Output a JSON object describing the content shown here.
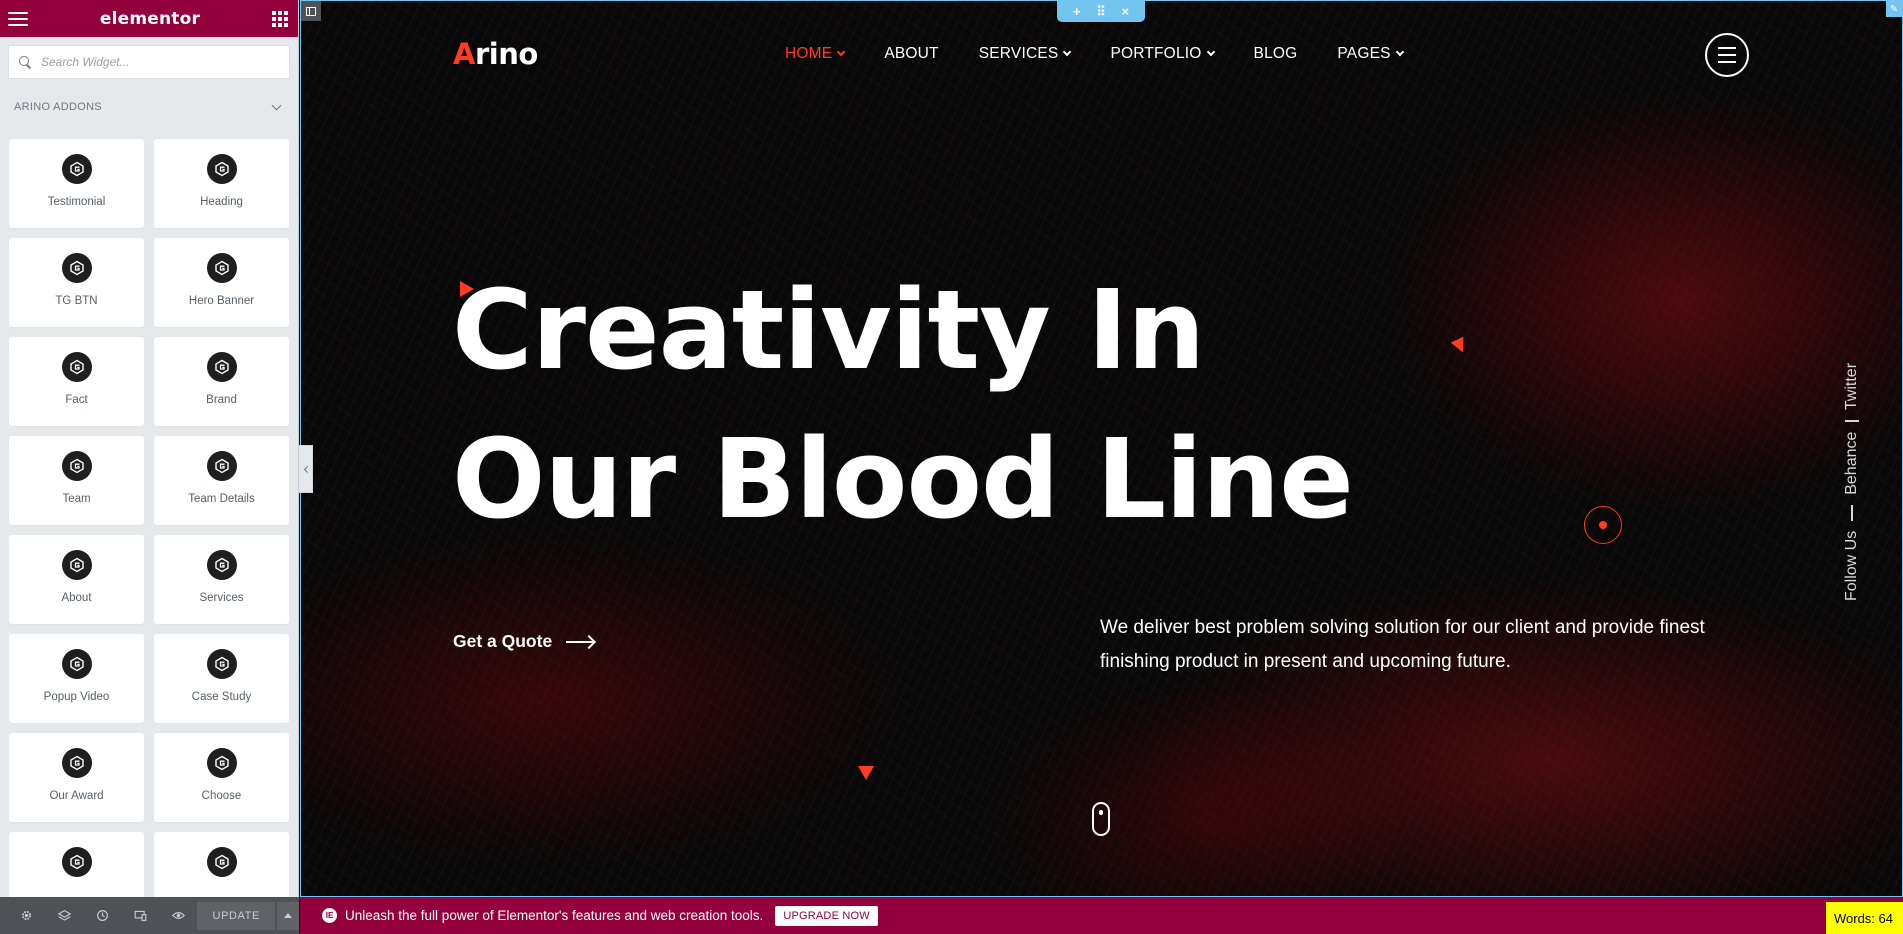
{
  "sidebar": {
    "brand": "elementor",
    "search_placeholder": "Search Widget...",
    "category": "ARINO ADDONS",
    "widgets": [
      {
        "label": "Testimonial"
      },
      {
        "label": "Heading"
      },
      {
        "label": "TG BTN"
      },
      {
        "label": "Hero Banner"
      },
      {
        "label": "Fact"
      },
      {
        "label": "Brand"
      },
      {
        "label": "Team"
      },
      {
        "label": "Team Details"
      },
      {
        "label": "About"
      },
      {
        "label": "Services"
      },
      {
        "label": "Popup Video"
      },
      {
        "label": "Case Study"
      },
      {
        "label": "Our Award"
      },
      {
        "label": "Choose"
      },
      {
        "label": ""
      },
      {
        "label": ""
      }
    ],
    "footer": {
      "update_label": "UPDATE",
      "icons": [
        "settings-icon",
        "layers-icon",
        "history-icon",
        "responsive-icon",
        "preview-icon"
      ]
    }
  },
  "site": {
    "logo_initial": "A",
    "logo_rest": "rino",
    "nav": [
      {
        "label": "HOME",
        "active": true,
        "dropdown": true
      },
      {
        "label": "ABOUT",
        "active": false,
        "dropdown": false
      },
      {
        "label": "SERVICES",
        "active": false,
        "dropdown": true
      },
      {
        "label": "PORTFOLIO",
        "active": false,
        "dropdown": true
      },
      {
        "label": "BLOG",
        "active": false,
        "dropdown": false
      },
      {
        "label": "PAGES",
        "active": false,
        "dropdown": true
      }
    ],
    "hero": {
      "line1": "Creativity In",
      "line2": "Our Blood Line",
      "cta": "Get a Quote",
      "description": "We deliver best problem solving solution for our client and provide finest finishing product in present and upcoming future."
    },
    "social": {
      "label": "Follow Us",
      "links": [
        "Behance",
        "Twitter"
      ]
    }
  },
  "promo": {
    "text": "Unleash the full power of Elementor's features and web creation tools.",
    "button": "UPGRADE NOW"
  },
  "word_count": "Words: 64",
  "colors": {
    "elementor_brand": "#93003c",
    "accent": "#ff3c21",
    "editor_blue": "#71c5ef"
  }
}
